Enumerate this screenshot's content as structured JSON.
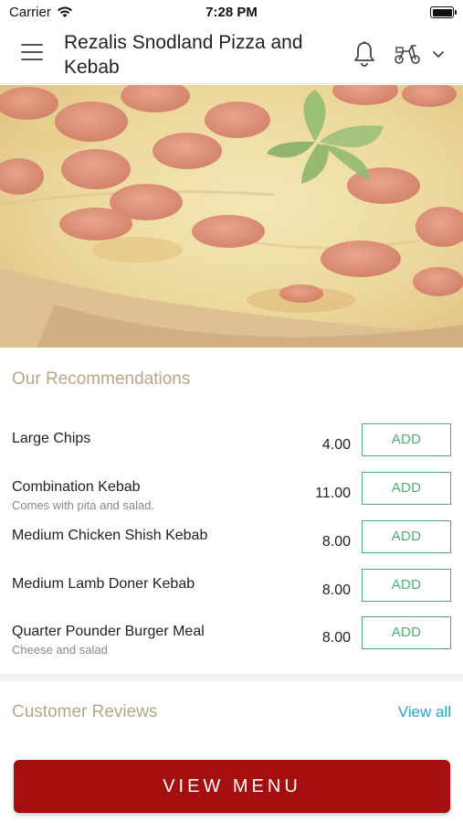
{
  "status_bar": {
    "carrier": "Carrier",
    "time": "7:28 PM"
  },
  "header": {
    "title": "Rezalis Snodland Pizza and Kebab",
    "icons": [
      "menu-icon",
      "bell-icon",
      "scooter-icon",
      "chevron-down-icon"
    ]
  },
  "hero": {
    "image": "pepperoni-pizza"
  },
  "recommendations": {
    "title": "Our Recommendations",
    "add_label": "ADD",
    "items": [
      {
        "name": "Large Chips",
        "description": "",
        "price": "4.00"
      },
      {
        "name": "Combination Kebab",
        "description": "Comes with pita and salad.",
        "price": "11.00"
      },
      {
        "name": "Medium Chicken Shish Kebab",
        "description": "",
        "price": "8.00"
      },
      {
        "name": "Medium Lamb Doner Kebab",
        "description": "",
        "price": "8.00"
      },
      {
        "name": "Quarter Pounder Burger Meal",
        "description": "Cheese and salad",
        "price": "8.00"
      }
    ]
  },
  "reviews": {
    "title": "Customer Reviews",
    "view_all": "View all"
  },
  "footer": {
    "view_menu": "VIEW MENU"
  },
  "colors": {
    "accent_red": "#a60f0f",
    "add_green": "#4caf6e",
    "section_title": "#b5a787",
    "link_blue": "#2aa3c8"
  }
}
